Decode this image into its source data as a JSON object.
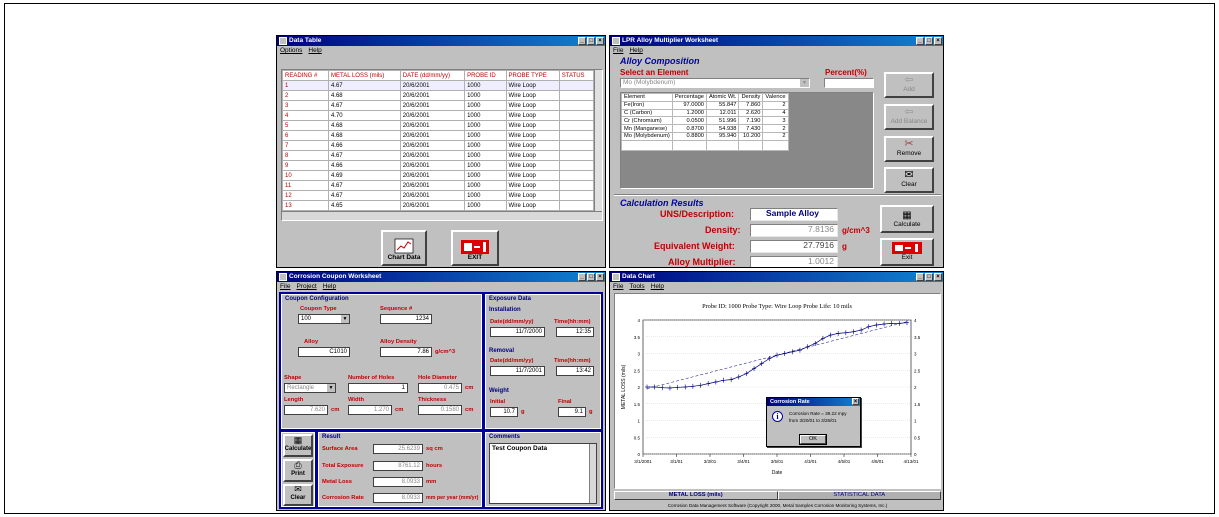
{
  "data_table": {
    "title": "Data Table",
    "menu": [
      "Options",
      "Help"
    ],
    "columns": [
      "READING #",
      "METAL LOSS (mils)",
      "DATE (dd/mm/yy)",
      "PROBE ID",
      "PROBE TYPE",
      "STATUS"
    ],
    "rows": [
      [
        "1",
        "4.67",
        "20/6/2001",
        "1000",
        "Wire Loop",
        ""
      ],
      [
        "2",
        "4.68",
        "20/6/2001",
        "1000",
        "Wire Loop",
        ""
      ],
      [
        "3",
        "4.67",
        "20/6/2001",
        "1000",
        "Wire Loop",
        ""
      ],
      [
        "4",
        "4.70",
        "20/6/2001",
        "1000",
        "Wire Loop",
        ""
      ],
      [
        "5",
        "4.68",
        "20/6/2001",
        "1000",
        "Wire Loop",
        ""
      ],
      [
        "6",
        "4.68",
        "20/6/2001",
        "1000",
        "Wire Loop",
        ""
      ],
      [
        "7",
        "4.66",
        "20/6/2001",
        "1000",
        "Wire Loop",
        ""
      ],
      [
        "8",
        "4.67",
        "20/6/2001",
        "1000",
        "Wire Loop",
        ""
      ],
      [
        "9",
        "4.66",
        "20/6/2001",
        "1000",
        "Wire Loop",
        ""
      ],
      [
        "10",
        "4.69",
        "20/6/2001",
        "1000",
        "Wire Loop",
        ""
      ],
      [
        "11",
        "4.67",
        "20/6/2001",
        "1000",
        "Wire Loop",
        ""
      ],
      [
        "12",
        "4.67",
        "20/6/2001",
        "1000",
        "Wire Loop",
        ""
      ],
      [
        "13",
        "4.65",
        "20/6/2001",
        "1000",
        "Wire Loop",
        ""
      ]
    ],
    "chart_button": "Chart Data",
    "exit_button": "EXIT"
  },
  "lpr": {
    "title": "LPR Alloy Multiplier Worksheet",
    "menu": [
      "File",
      "Help"
    ],
    "section_alloy": "Alloy Composition",
    "select_label": "Select an Element",
    "select_value": "Mo (Molybdenum)",
    "percent_label": "Percent(%)",
    "columns": [
      "Element",
      "Percentage",
      "Atomic Wt.",
      "Density",
      "Valence"
    ],
    "rows": [
      [
        "Fe(Iron)",
        "97.0000",
        "55.847",
        "7.860",
        "2"
      ],
      [
        "C (Carbon)",
        "1.2000",
        "12.011",
        "2.620",
        "4"
      ],
      [
        "Cr (Chromium)",
        "0.0500",
        "51.996",
        "7.190",
        "3"
      ],
      [
        "Mn (Manganese)",
        "0.8700",
        "54.938",
        "7.430",
        "2"
      ],
      [
        "Mo (Molybdenum)",
        "0.8800",
        "95.940",
        "10.200",
        "2"
      ]
    ],
    "buttons": {
      "add": "Add",
      "add_balance": "Add Balance",
      "remove": "Remove",
      "clear": "Clear",
      "calculate": "Calculate",
      "exit": "Exit"
    },
    "section_results": "Calculation Results",
    "uns_label": "UNS/Description:",
    "uns_value": "Sample Alloy",
    "density_label": "Density:",
    "density_value": "7.8136",
    "density_unit": "g/cm^3",
    "eqw_label": "Equivalent Weight:",
    "eqw_value": "27.7916",
    "eqw_unit": "g",
    "am_label": "Alloy Multiplier:",
    "am_value": "1.0012"
  },
  "coupon": {
    "title": "Corrosion Coupon Worksheet",
    "menu": [
      "File",
      "Project",
      "Help"
    ],
    "config_header": "Coupon Configuration",
    "coupon_type_label": "Coupon Type",
    "coupon_type": "100",
    "sequence_label": "Sequence #",
    "sequence": "1234",
    "alloy_label": "Alloy",
    "alloy": "C1010",
    "alloy_density_label": "Alloy Density",
    "alloy_density": "7.86",
    "density_unit": "g/cm^3",
    "shape_label": "Shape",
    "shape": "Rectangle",
    "holes_label": "Number of Holes",
    "holes": "1",
    "hole_dia_label": "Hole Diameter",
    "hole_dia": "0.475",
    "length_label": "Length",
    "length": "7.620",
    "width_label": "Width",
    "width": "1.270",
    "thickness_label": "Thickness",
    "thickness": "0.1580",
    "cm": "cm",
    "exposure_header": "Exposure Data",
    "installation": "Installation",
    "date_label": "Date(dd/mm/yy)",
    "time_label": "Time(hh:mm)",
    "install_date": "11/7/2000",
    "install_time": "12:35",
    "removal": "Removal",
    "removal_date": "11/7/2001",
    "removal_time": "13:42",
    "weight": "Weight",
    "initial_label": "Initial",
    "initial": "10.7",
    "final_label": "Final",
    "final": "9.1",
    "g": "g",
    "result_header": "Result",
    "surface_area_label": "Surface Area",
    "surface_area": "25.6239",
    "surface_area_unit": "sq cm",
    "total_exposure_label": "Total Exposure",
    "total_exposure": "8761.12",
    "total_exposure_unit": "hours",
    "metal_loss_label": "Metal Loss",
    "metal_loss": "8.0933",
    "metal_loss_unit": "mm",
    "corrosion_rate_label": "Corrosion Rate",
    "corrosion_rate": "8.0933",
    "corrosion_rate_unit": "mm per year (mm/yr)",
    "comments_header": "Comments",
    "comments": "Test Coupon Data",
    "buttons": {
      "calculate": "Calculate",
      "print": "Print",
      "clear": "Clear"
    }
  },
  "chart_window": {
    "title": "Data Chart",
    "menu": [
      "File",
      "Tools",
      "Help"
    ],
    "tabs": [
      "METAL LOSS (mils)",
      "STATISTICAL DATA"
    ],
    "status": "Corrosion Data Management Software (Copyright 2000, Metal Samples Corrosion Monitoring Systems, Inc.)",
    "dialog": {
      "title": "Corrosion Rate",
      "line1": "Corrosion Rate = 39.22 mpy",
      "line2": "from 3/20/01 to 3/26/01",
      "ok": "OK"
    }
  },
  "chart_data": {
    "type": "line",
    "title": "Probe ID: 1000   Probe Type: Wire Loop   Probe Life: 10 mils",
    "xlabel": "Date",
    "ylabel": "METAL LOSS (mils)",
    "x_ticks": [
      "3/1/2001",
      "3/1/01",
      "3/3/01",
      "3/4/01",
      "3/5/01",
      "4/3/01",
      "4/5/01",
      "4/8/01",
      "4/13/01"
    ],
    "y_ticks": [
      0.0,
      0.5,
      1.0,
      1.5,
      2.0,
      2.5,
      3.0,
      3.5,
      4.0
    ],
    "ylim": [
      0,
      4.0
    ],
    "series": [
      {
        "values": [
          2.0,
          2.0,
          1.98,
          1.97,
          1.99,
          2.0,
          2.02,
          2.05,
          2.1,
          2.15,
          2.2,
          2.22,
          2.3,
          2.4,
          2.55,
          2.7,
          2.85,
          2.95,
          3.0,
          3.05,
          3.1,
          3.2,
          3.3,
          3.45,
          3.55,
          3.6,
          3.62,
          3.65,
          3.7,
          3.8,
          3.85,
          3.88,
          3.9,
          3.9,
          3.92
        ]
      },
      {
        "values": [
          1.95,
          3.95
        ]
      }
    ]
  }
}
